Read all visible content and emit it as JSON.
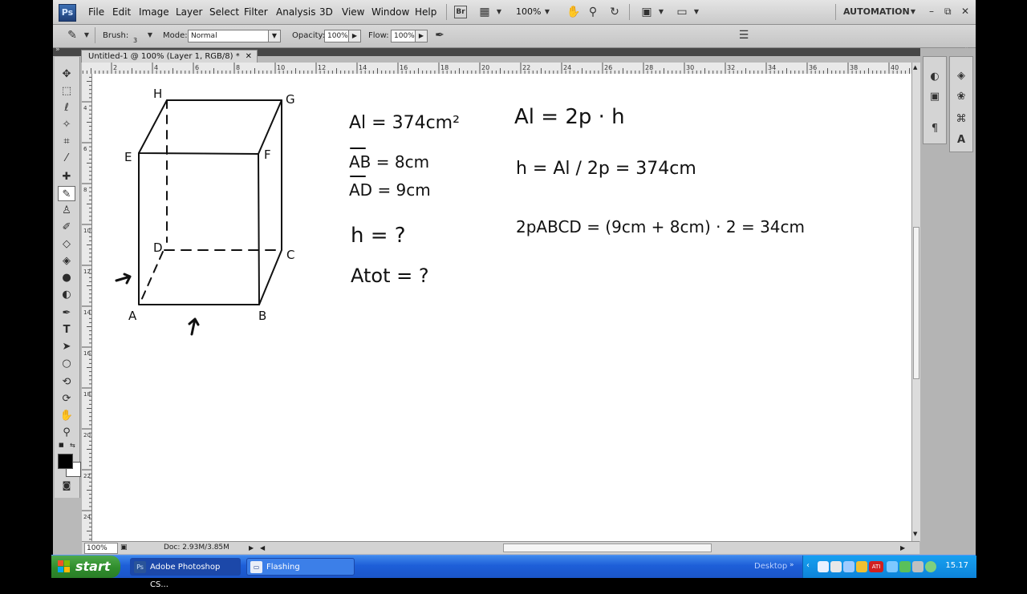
{
  "menubar": {
    "logo": "Ps",
    "items": [
      "File",
      "Edit",
      "Image",
      "Layer",
      "Select",
      "Filter",
      "Analysis",
      "3D",
      "View",
      "Window",
      "Help"
    ],
    "bridge_label": "Br",
    "zoom": "100%",
    "workspace": "AUTOMATION"
  },
  "options": {
    "brush_label": "Brush:",
    "brush_size": "3",
    "mode_label": "Mode:",
    "mode_value": "Normal",
    "opacity_label": "Opacity:",
    "opacity_value": "100%",
    "flow_label": "Flow:",
    "flow_value": "100%"
  },
  "document": {
    "tab_title": "Untitled-1 @ 100% (Layer 1, RGB/8) *",
    "zoom": "100%",
    "doc_size": "Doc: 2.93M/3.85M"
  },
  "rulers": {
    "h_labels": [
      "2",
      "4",
      "6",
      "8",
      "10",
      "12",
      "14",
      "16",
      "18",
      "20",
      "22",
      "24",
      "26",
      "28",
      "30",
      "32",
      "34",
      "36",
      "38",
      "40"
    ],
    "v_labels": [
      "4",
      "6",
      "8",
      "10",
      "12",
      "14",
      "16",
      "18",
      "20",
      "22",
      "24"
    ]
  },
  "drawing": {
    "vertex_labels": [
      "H",
      "G",
      "E",
      "F",
      "D",
      "C",
      "A",
      "B"
    ],
    "formulas": [
      "Al = 374cm²",
      "AB = 8cm",
      "AD = 9cm",
      "h = ?",
      "Atot = ?",
      "Al = 2p · h",
      "h = Al / 2p = 374cm",
      "2pABCD = (9cm + 8cm) · 2 = 34cm"
    ]
  },
  "taskbar": {
    "start": "start",
    "tasks": [
      "Adobe Photoshop CS...",
      "Flashing"
    ],
    "desktop": "Desktop",
    "clock": "15.17"
  },
  "colors": {
    "taskbar": "#1d5ed8",
    "start": "#2f8d2c",
    "ps_logo": "#2a5499"
  }
}
